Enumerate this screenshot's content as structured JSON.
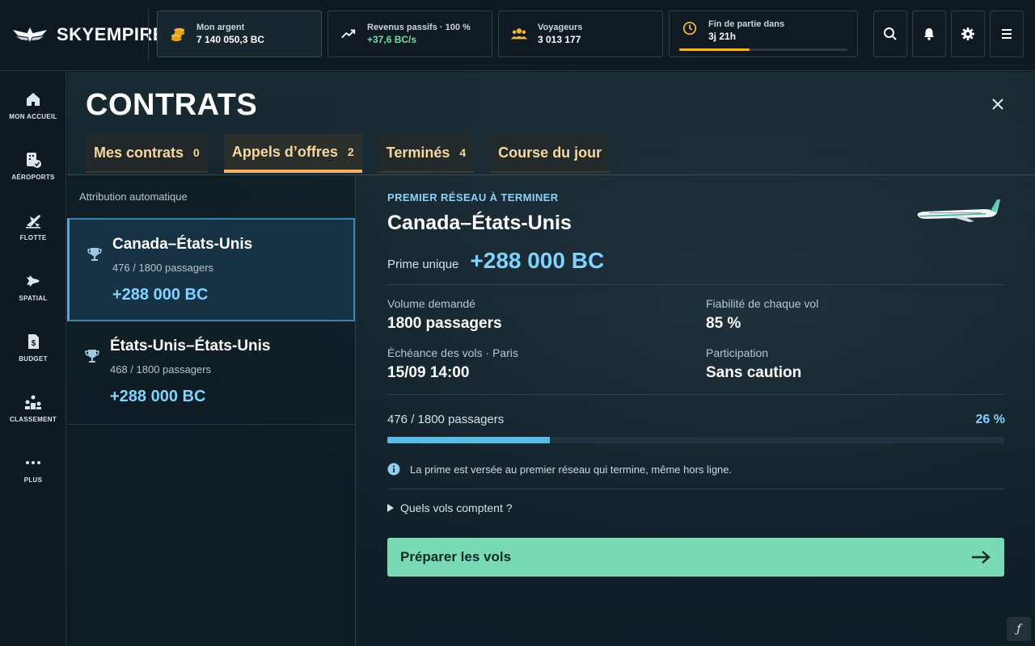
{
  "brand": {
    "name": "SKYEMPIRE"
  },
  "stats": {
    "money": {
      "label": "Mon argent",
      "value": "7 140 050,3 BC",
      "icon": "coins-icon"
    },
    "income": {
      "label": "Revenus passifs · 100 %",
      "value": "+37,6 BC/s",
      "icon": "trend-up-icon"
    },
    "travelers": {
      "label": "Voyageurs",
      "value": "3 013 177",
      "icon": "users-icon"
    },
    "endgame": {
      "label": "Fin de partie dans",
      "value": "3j 21h",
      "icon": "clock-icon",
      "progress": 0.42
    }
  },
  "topbar_actions": [
    "search-icon",
    "bell-icon",
    "gear-icon",
    "menu-icon"
  ],
  "sidebar": {
    "items": [
      {
        "label": "MON ACCUEIL",
        "icon": "home-icon"
      },
      {
        "label": "AÉROPORTS",
        "icon": "airport-icon"
      },
      {
        "label": "FLOTTE",
        "icon": "plane-icon"
      },
      {
        "label": "SPATIAL",
        "icon": "rocket-icon"
      },
      {
        "label": "BUDGET",
        "icon": "budget-icon"
      },
      {
        "label": "CLASSEMENT",
        "icon": "ranking-icon"
      },
      {
        "label": "PLUS",
        "icon": "more-icon"
      }
    ]
  },
  "page": {
    "title": "CONTRATS"
  },
  "tabs": [
    {
      "label": "Mes contrats",
      "count": "0"
    },
    {
      "label": "Appels d’offres",
      "count": "2"
    },
    {
      "label": "Terminés",
      "count": "4"
    },
    {
      "label": "Course du jour",
      "count": ""
    }
  ],
  "list": {
    "auto_label": "Attribution automatique",
    "contracts": [
      {
        "name": "Canada–États-Unis",
        "passengers": "476 / 1800 passagers",
        "bonus": "+288 000 BC"
      },
      {
        "name": "États-Unis–États-Unis",
        "passengers": "468 / 1800 passagers",
        "bonus": "+288 000 BC"
      }
    ]
  },
  "detail": {
    "kicker": "PREMIER RÉSEAU À TERMINER",
    "title": "Canada–États-Unis",
    "prime_label": "Prime unique",
    "prime_value": "+288 000 BC",
    "fields": {
      "volume_label": "Volume demandé",
      "volume_value": "1800 passagers",
      "reliability_label": "Fiabilité de chaque vol",
      "reliability_value": "85 %",
      "deadline_label": "Échéance des vols · Paris",
      "deadline_value": "15/09 14:00",
      "participation_label": "Participation",
      "participation_value": "Sans caution"
    },
    "progress_label": "476 / 1800 passagers",
    "progress_pct": "26 %",
    "progress_value": 0.264,
    "info": "La prime est versée au premier réseau qui termine, même hors ligne.",
    "disclosure": "Quels vols comptent ?",
    "cta": "Préparer les vols"
  },
  "colors": {
    "accent_blue": "#7fd3ff",
    "accent_green": "#79dab6",
    "accent_amber": "#f3b461",
    "income_green": "#6fe0a6"
  }
}
